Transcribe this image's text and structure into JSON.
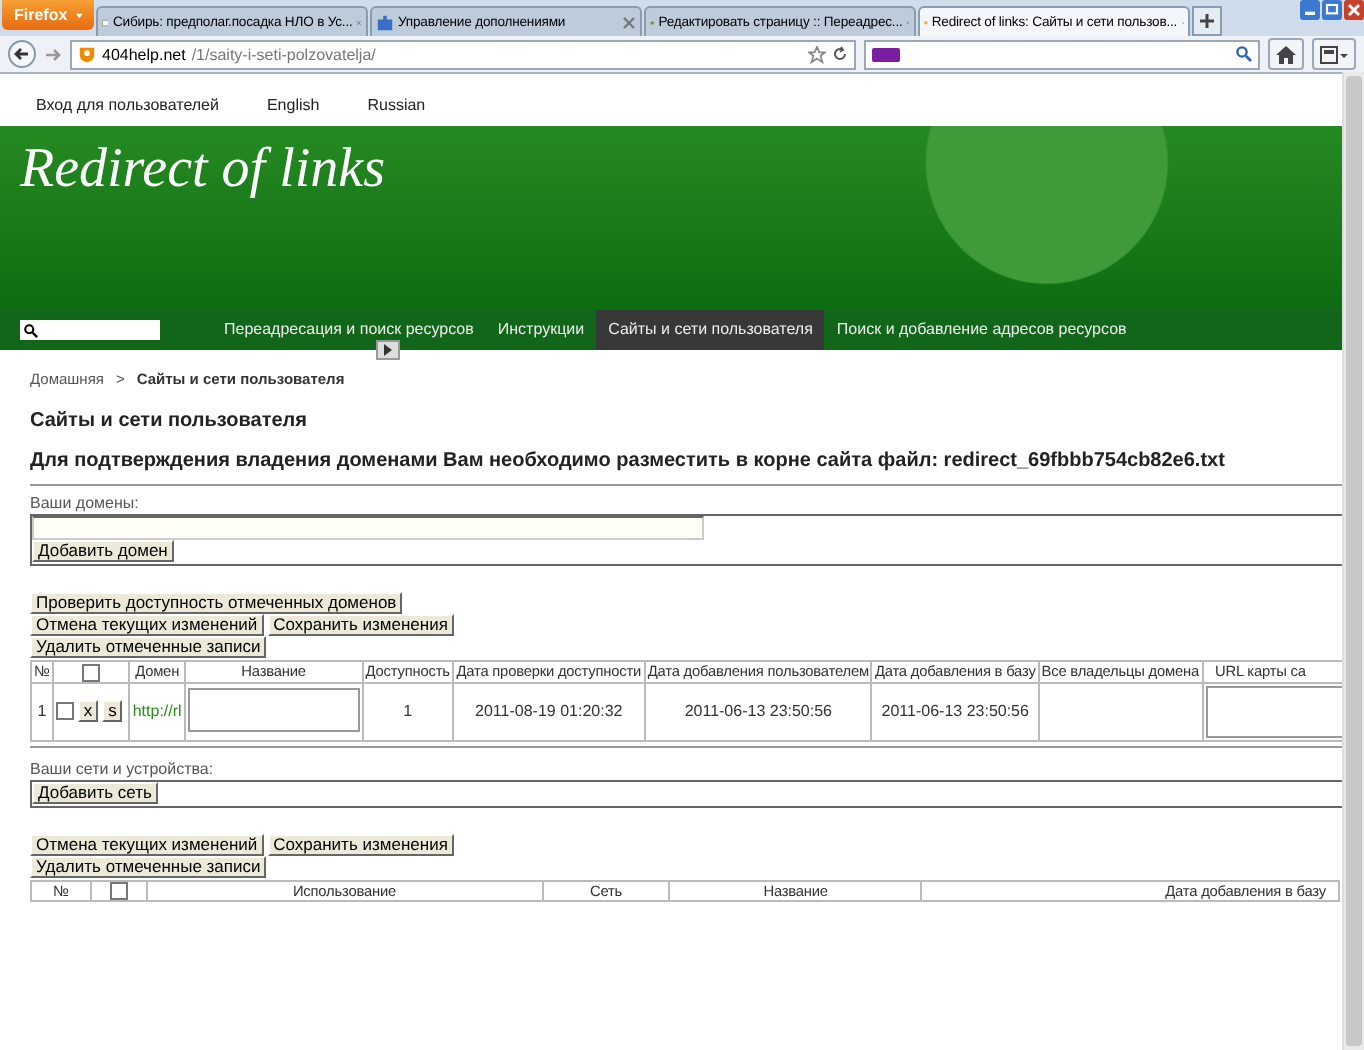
{
  "browser": {
    "menu_button": "Firefox",
    "tabs": [
      {
        "label": "Сибирь: предполаг.посадка НЛО в Ус...",
        "selected": false
      },
      {
        "label": "Управление дополнениями",
        "selected": false
      },
      {
        "label": "Редактировать страницу :: Переадрес...",
        "selected": false
      },
      {
        "label": "Redirect of links: Сайты и сети пользов...",
        "selected": true
      }
    ],
    "url_host": "404help.net",
    "url_path": "/1/saity-i-seti-polzovatelja/"
  },
  "top_links": [
    "Вход для пользователей",
    "English",
    "Russian"
  ],
  "site_title": "Redirect of links",
  "nav": [
    {
      "label": "Переадресация и поиск ресурсов",
      "selected": false
    },
    {
      "label": "Инструкции",
      "selected": false
    },
    {
      "label": "Сайты и сети пользователя",
      "selected": true
    },
    {
      "label": "Поиск и добавление адресов ресурсов",
      "selected": false
    }
  ],
  "breadcrumb": {
    "home": "Домашняя",
    "separator": ">",
    "current": "Сайты и сети пользователя"
  },
  "page_heading": "Сайты и сети пользователя",
  "notice": "Для подтверждения владения доменами Вам необходимо разместить в корне сайта файл: redirect_69fbbb754cb82e6.txt",
  "domains": {
    "label": "Ваши домены:",
    "add_button": "Добавить домен",
    "button_rows": [
      [
        "Проверить доступность отмеченных доменов"
      ],
      [
        "Отмена текущих изменений",
        "Сохранить изменения"
      ],
      [
        "Удалить отмеченные записи"
      ]
    ],
    "select_all_checked": false,
    "columns": [
      "№",
      "Домен",
      "Название",
      "Доступность",
      "Дата проверки доступности",
      "Дата добавления пользователем",
      "Дата добавления в базу",
      "Все владельцы домена",
      "URL карты са"
    ],
    "rows": [
      {
        "number": "1",
        "checked": false,
        "delete_button": "x",
        "save_button": "s",
        "domain": "http://rl",
        "availability": "1",
        "checked_at": "2011-08-19 01:20:32",
        "added_by_user": "2011-06-13 23:50:56",
        "added_to_db": "2011-06-13 23:50:56"
      }
    ]
  },
  "networks": {
    "label": "Ваши сети и устройства:",
    "add_button": "Добавить сеть",
    "button_rows": [
      [
        "Отмена текущих изменений",
        "Сохранить изменения"
      ],
      [
        "Удалить отмеченные записи"
      ]
    ],
    "select_all_checked": false,
    "columns": [
      "№",
      "Использование",
      "Сеть",
      "Название",
      "Дата добавления в базу"
    ]
  }
}
